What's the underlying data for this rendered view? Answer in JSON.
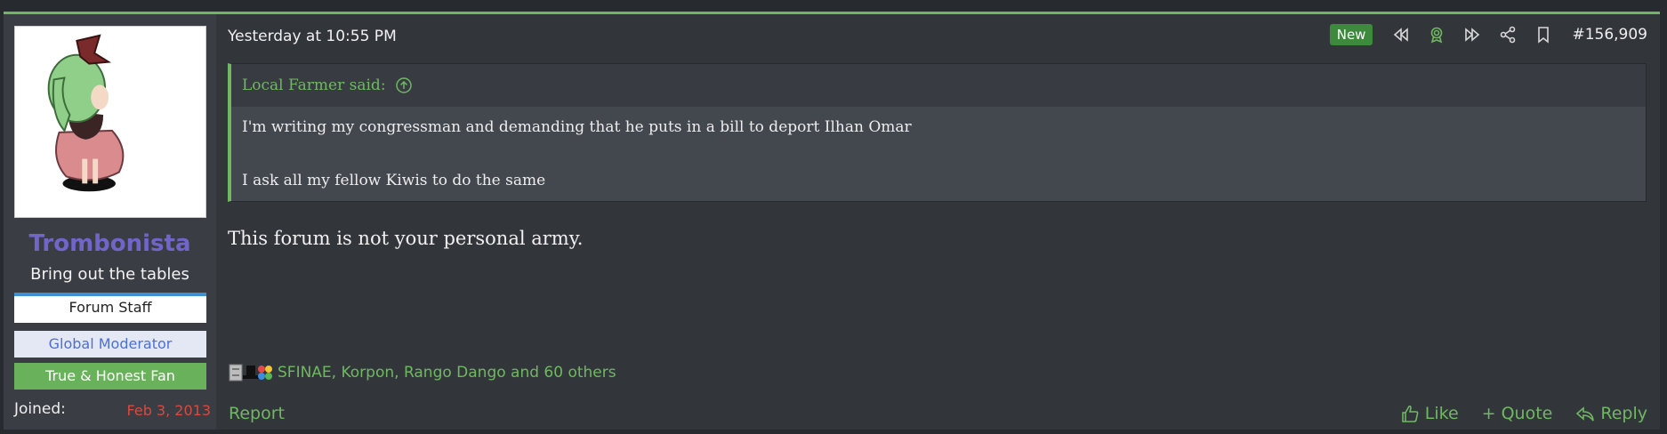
{
  "user": {
    "name": "Trombonista",
    "title": "Bring out the tables",
    "banners": [
      "Forum Staff",
      "Global Moderator",
      "True & Honest Fan"
    ],
    "joined_label": "Joined:",
    "joined_value": "Feb 3, 2013"
  },
  "post": {
    "date": "Yesterday at 10:55 PM",
    "badge": "New",
    "number": "#156,909",
    "quote": {
      "author": "Local Farmer said:",
      "lines": [
        "I'm writing my congressman and demanding that he puts in a bill to deport Ilhan Omar",
        "I ask all my fellow Kiwis to do the same"
      ]
    },
    "message": "This forum is not your personal army.",
    "reactions_text": "SFINAE, Korpon, Rango Dango and 60 others"
  },
  "footer": {
    "report": "Report",
    "like": "Like",
    "quote": "+ Quote",
    "reply": "Reply"
  },
  "colors": {
    "accent": "#6fb861",
    "username": "#7165c9",
    "joined_value": "#d8493f"
  }
}
